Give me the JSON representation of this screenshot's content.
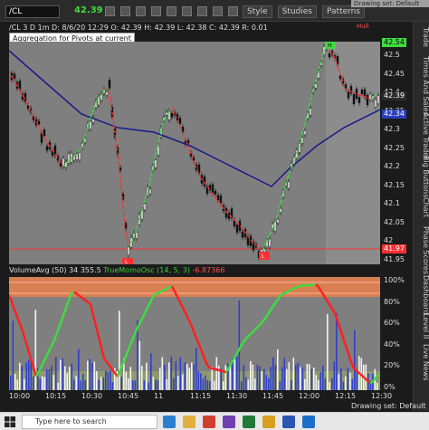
{
  "toolbar": {
    "symbol": "/CL",
    "last_price": "42.39",
    "style_label": "Style",
    "studies_label": "Studies",
    "patterns_label": "Patterns",
    "drawing_set_top": "Drawing set: Default"
  },
  "info_line": {
    "chart_id": "/CL 3 D 1m",
    "date": "D: 8/6/20 12:29",
    "open": "O: 42.39",
    "high": "H: 42.39",
    "low": "L: 42.38",
    "close": "C: 42.39",
    "change": "R: 0.01"
  },
  "aggregation_label": "Aggregation for Pivots at current",
  "hull_label": "Hull",
  "price_axis": {
    "ticks": [
      "42.5",
      "42.45",
      "42.4",
      "42.35",
      "42.3",
      "42.25",
      "42.2",
      "42.15",
      "42.1",
      "42.05",
      "42",
      "41.95"
    ],
    "current_price": "42.39",
    "green_level": "42.54",
    "blue_level": "42.34",
    "red_level": "41.97"
  },
  "pivot_markers": {
    "high": "H",
    "low1": "L",
    "low2": "L"
  },
  "indicator": {
    "volume_label": "VolumeAvg (50)",
    "volume_value1": "34",
    "volume_value2": "355.5",
    "osc_label": "TrueMomoOsc (14, 5, 3)",
    "osc_value": "-6.87366"
  },
  "osc_axis": {
    "ticks": [
      "100%",
      "80%",
      "60%",
      "40%",
      "20%",
      "0%"
    ]
  },
  "time_axis": {
    "labels": [
      "10:00",
      "10:15",
      "10:30",
      "10:45",
      "11",
      "11:15",
      "11:30",
      "11:45",
      "12:00",
      "12:15",
      "12:30"
    ]
  },
  "drawing_set_bottom": "Drawing set: Default",
  "sidebar": {
    "items": [
      "Trade",
      "Times And Sales",
      "Active Trader",
      "Big Buttons",
      "Chart",
      "Phase Scores",
      "Dashboard",
      "Level II",
      "Live News"
    ]
  },
  "taskbar": {
    "search_placeholder": "Type here to search",
    "apps": [
      "edge",
      "files",
      "chrome",
      "store",
      "excel",
      "folder",
      "word",
      "mail"
    ]
  },
  "colors": {
    "chart_bg": "#7f7f7f",
    "bull": "#3fdc3f",
    "bear": "#ff3030",
    "ma": "#1a1a8a"
  }
}
